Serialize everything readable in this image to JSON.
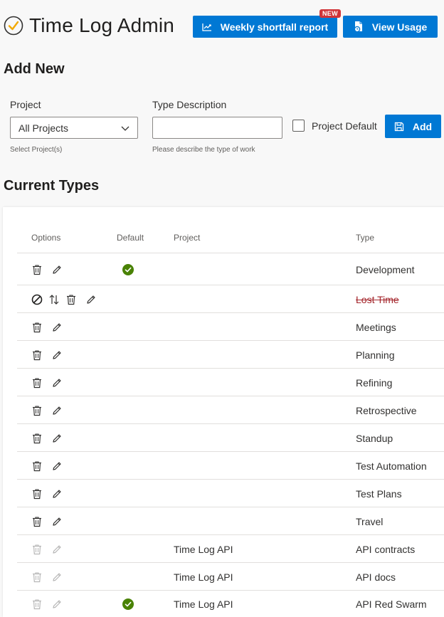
{
  "header": {
    "title": "Time Log Admin",
    "weekly_report_label": "Weekly shortfall report",
    "new_badge": "NEW",
    "view_usage_label": "View Usage"
  },
  "add_new": {
    "title": "Add New",
    "project_label": "Project",
    "project_value": "All Projects",
    "project_hint": "Select Project(s)",
    "type_label": "Type Description",
    "type_value": "",
    "type_hint": "Please describe the type of work",
    "default_label": "Project Default",
    "add_label": "Add"
  },
  "current_types": {
    "title": "Current Types",
    "columns": {
      "options": "Options",
      "default": "Default",
      "project": "Project",
      "type": "Type"
    },
    "rows": [
      {
        "type": "Development",
        "project": "",
        "default": true,
        "state": "active"
      },
      {
        "type": "Lost Time",
        "project": "",
        "default": false,
        "state": "disabled"
      },
      {
        "type": "Meetings",
        "project": "",
        "default": false,
        "state": "active"
      },
      {
        "type": "Planning",
        "project": "",
        "default": false,
        "state": "active"
      },
      {
        "type": "Refining",
        "project": "",
        "default": false,
        "state": "active"
      },
      {
        "type": "Retrospective",
        "project": "",
        "default": false,
        "state": "active"
      },
      {
        "type": "Standup",
        "project": "",
        "default": false,
        "state": "active"
      },
      {
        "type": "Test Automation",
        "project": "",
        "default": false,
        "state": "active"
      },
      {
        "type": "Test Plans",
        "project": "",
        "default": false,
        "state": "active"
      },
      {
        "type": "Travel",
        "project": "",
        "default": false,
        "state": "active"
      },
      {
        "type": "API contracts",
        "project": "Time Log API",
        "default": false,
        "state": "readonly"
      },
      {
        "type": "API docs",
        "project": "Time Log API",
        "default": false,
        "state": "readonly"
      },
      {
        "type": "API Red Swarm",
        "project": "Time Log API",
        "default": true,
        "state": "readonly"
      }
    ]
  },
  "colors": {
    "primary": "#0078d4",
    "badge": "#d13438",
    "success": "#498205",
    "strike": "#a4262c"
  }
}
